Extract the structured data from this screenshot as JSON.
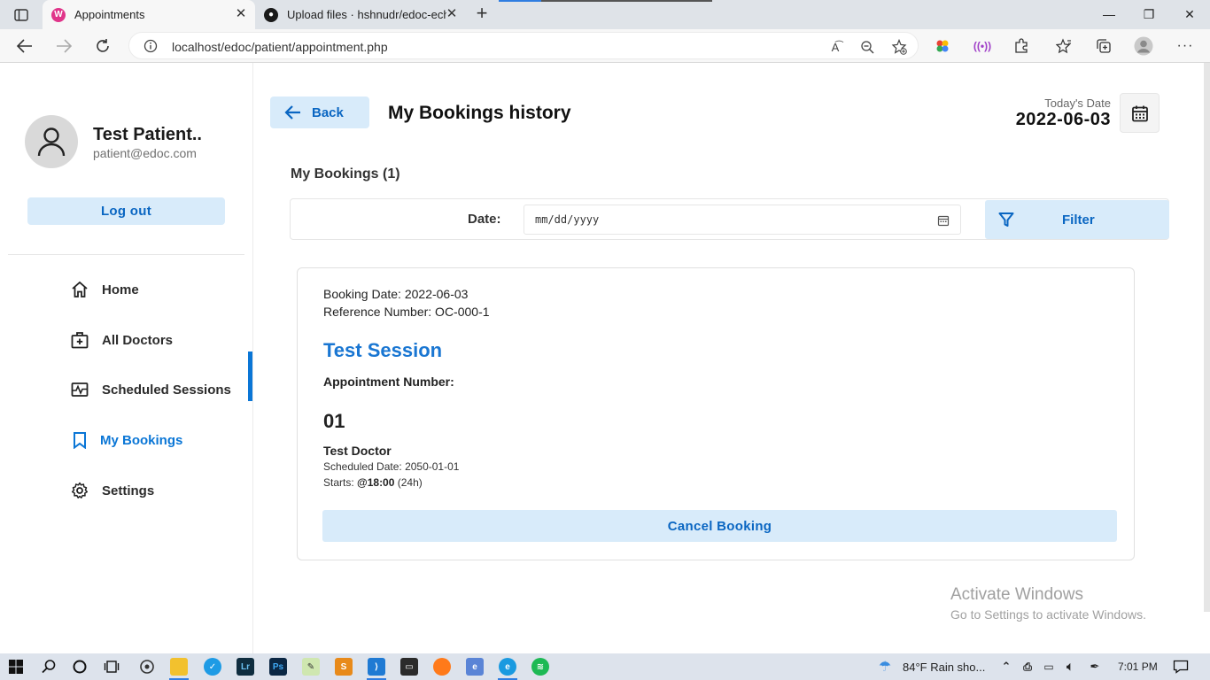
{
  "browser": {
    "tabs": [
      {
        "title": "Appointments",
        "active": true
      },
      {
        "title": "Upload files · hshnudr/edoc-echa",
        "active": false
      }
    ],
    "url": "localhost/edoc/patient/appointment.php"
  },
  "sidebar": {
    "profile_name": "Test Patient..",
    "profile_email": "patient@edoc.com",
    "logout_label": "Log out",
    "menu": [
      {
        "label": "Home",
        "icon": "home-icon"
      },
      {
        "label": "All Doctors",
        "icon": "medical-bag-icon"
      },
      {
        "label": "Scheduled Sessions",
        "icon": "pulse-icon"
      },
      {
        "label": "My Bookings",
        "icon": "bookmark-icon",
        "active": true
      },
      {
        "label": "Settings",
        "icon": "gear-icon"
      }
    ]
  },
  "header": {
    "back_label": "Back",
    "title": "My Bookings history",
    "today_label": "Today's Date",
    "today_value": "2022-06-03"
  },
  "filter": {
    "count_label": "My Bookings (1)",
    "date_label": "Date:",
    "date_placeholder": "mm/dd/yyyy",
    "filter_label": "Filter"
  },
  "booking": {
    "booking_date": "Booking Date: 2022-06-03",
    "reference": "Reference Number: OC-000-1",
    "session_title": "Test Session",
    "appointment_label": "Appointment Number:",
    "appointment_number": "01",
    "doctor": "Test Doctor",
    "scheduled_date": "Scheduled Date: 2050-01-01",
    "starts_prefix": "Starts: ",
    "starts_time": "@18:00",
    "starts_suffix": " (24h)",
    "cancel_label": "Cancel Booking"
  },
  "watermark": {
    "title": "Activate Windows",
    "subtitle": "Go to Settings to activate Windows."
  },
  "taskbar": {
    "weather": "84°F  Rain sho...",
    "time": "7:01 PM"
  },
  "colors": {
    "accent": "#0a76d6",
    "button_bg": "#d8ebfa",
    "session_title": "#1976d2"
  }
}
